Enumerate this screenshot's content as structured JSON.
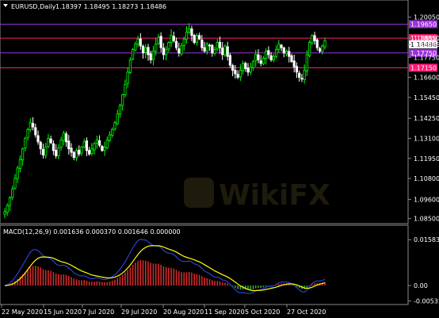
{
  "chart_data": {
    "type": "candlestick",
    "main": {
      "title": "EURUSD,Daily",
      "ohlc_text": "1.18397 1.18495 1.18273 1.18486",
      "ylim": [
        1.083,
        1.204
      ],
      "yticks": [
        1.2005,
        1.1885,
        1.18486,
        1.1775,
        1.166,
        1.1545,
        1.1425,
        1.131,
        1.1195,
        1.108,
        1.096,
        1.085
      ],
      "ytick_labels": [
        "1.20050",
        "1.18850",
        "1.18486",
        "1.17750",
        "1.16600",
        "1.15450",
        "1.14250",
        "1.13100",
        "1.11950",
        "1.10800",
        "1.09600",
        "1.08500"
      ],
      "horizontal_levels": [
        {
          "value": 1.1965,
          "color": "#9b30d9",
          "label": "1.19650"
        },
        {
          "value": 1.1885,
          "color": "#ff1a75",
          "label": "1.18850"
        },
        {
          "value": 1.18,
          "color": "#9b30d9",
          "label": "1.17750"
        },
        {
          "value": 1.1715,
          "color": "#ff1a75",
          "label": "1.17150"
        }
      ],
      "current_price": "1.18486",
      "up_color": "#00ff00",
      "down_color": "#ffffff",
      "close_series": [
        1.089,
        1.0925,
        1.097,
        1.102,
        1.108,
        1.114,
        1.119,
        1.125,
        1.131,
        1.136,
        1.14,
        1.1375,
        1.133,
        1.129,
        1.125,
        1.1215,
        1.126,
        1.131,
        1.1285,
        1.124,
        1.121,
        1.1255,
        1.13,
        1.134,
        1.129,
        1.125,
        1.123,
        1.12,
        1.124,
        1.122,
        1.126,
        1.129,
        1.124,
        1.122,
        1.125,
        1.128,
        1.13,
        1.127,
        1.124,
        1.126,
        1.13,
        1.133,
        1.136,
        1.14,
        1.145,
        1.15,
        1.156,
        1.162,
        1.169,
        1.176,
        1.182,
        1.185,
        1.188,
        1.184,
        1.18,
        1.183,
        1.179,
        1.176,
        1.181,
        1.185,
        1.189,
        1.183,
        1.179,
        1.182,
        1.186,
        1.19,
        1.187,
        1.183,
        1.18,
        1.184,
        1.188,
        1.192,
        1.194,
        1.19,
        1.186,
        1.19,
        1.188,
        1.183,
        1.181,
        1.185,
        1.184,
        1.18,
        1.182,
        1.186,
        1.183,
        1.179,
        1.184,
        1.178,
        1.173,
        1.17,
        1.168,
        1.166,
        1.17,
        1.174,
        1.171,
        1.169,
        1.172,
        1.175,
        1.179,
        1.176,
        1.174,
        1.177,
        1.181,
        1.179,
        1.176,
        1.178,
        1.182,
        1.185,
        1.183,
        1.18,
        1.181,
        1.178,
        1.175,
        1.172,
        1.169,
        1.166,
        1.165,
        1.17,
        1.179,
        1.186,
        1.19,
        1.187,
        1.183,
        1.181,
        1.184,
        1.187
      ]
    },
    "indicator": {
      "title": "MACD(12,26,9) 0.001636 0.000370 0.001646 0.000000",
      "ylim": [
        -0.006,
        0.017
      ],
      "yticks": [
        0.015838,
        0.0,
        -0.005331
      ],
      "ytick_labels": [
        "0.015838",
        "0.00",
        "-0.005331"
      ],
      "series": [
        {
          "name": "Signal",
          "color": "#ffff00"
        },
        {
          "name": "Main",
          "color": "#2b3fd6"
        }
      ],
      "histogram_up_color": "#d42a2a",
      "histogram_down_color": "#3aa63a"
    },
    "x_tick_labels": [
      "22 May 2020",
      "15 Jun 2020",
      "7 Jul 2020",
      "29 Jul 2020",
      "20 Aug 2020",
      "11 Sep 2020",
      "5 Oct 2020",
      "27 Oct 2020"
    ],
    "watermark": "WikiFX"
  }
}
